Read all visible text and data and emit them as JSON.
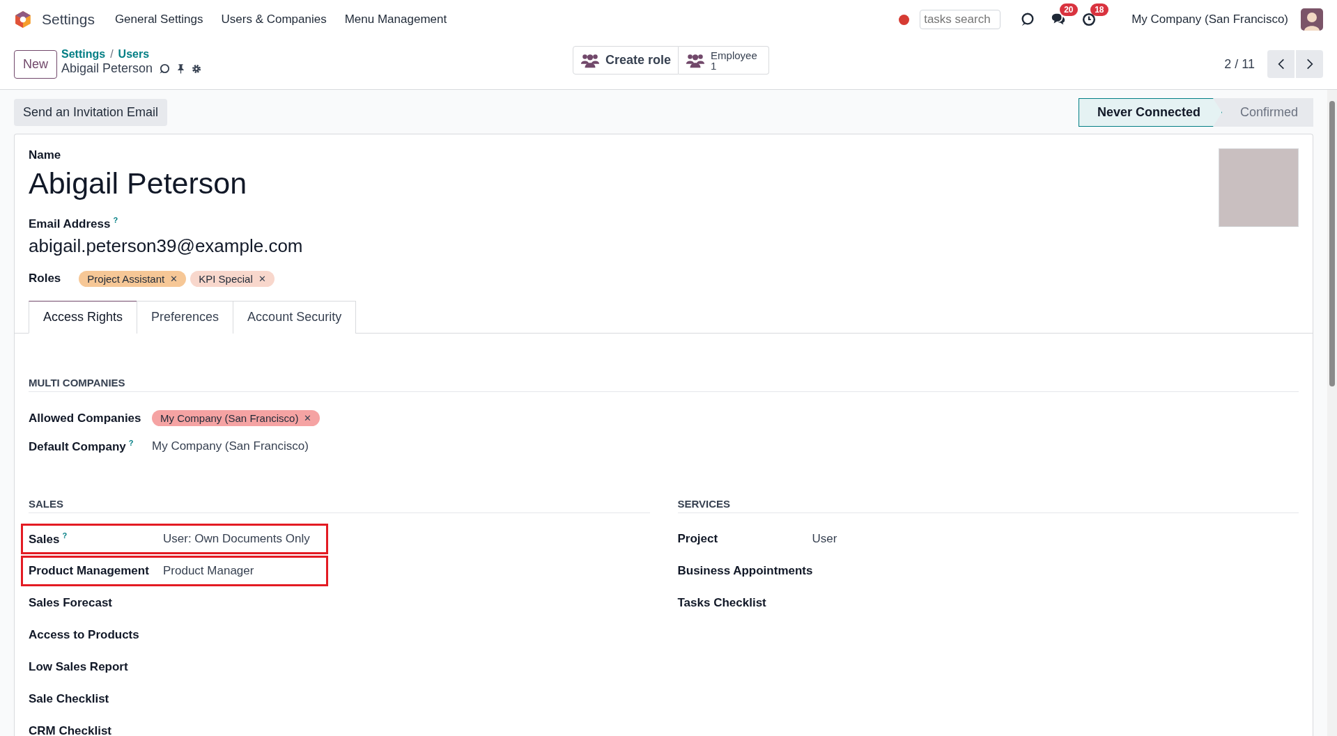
{
  "navbar": {
    "app_name": "Settings",
    "menu": [
      "General Settings",
      "Users & Companies",
      "Menu Management"
    ],
    "search": {
      "placeholder": "tasks search"
    },
    "messages_badge": "20",
    "activities_badge": "18",
    "company": "My Company (San Francisco)"
  },
  "control_panel": {
    "new_button": "New",
    "breadcrumbs": [
      "Settings",
      "Users"
    ],
    "breadcrumb_separator": "/",
    "record_title": "Abigail Peterson",
    "smart_buttons": [
      {
        "label": "Create role"
      },
      {
        "label": "Employee",
        "count": "1"
      }
    ],
    "pager": "2 / 11"
  },
  "header": {
    "action_button": "Send an Invitation Email",
    "statusbar": [
      {
        "label": "Never Connected",
        "selected": true
      },
      {
        "label": "Confirmed",
        "selected": false
      }
    ]
  },
  "form": {
    "name_label": "Name",
    "name": "Abigail Peterson",
    "email_label": "Email Address",
    "email_help": "?",
    "email": "abigail.peterson39@example.com",
    "roles_label": "Roles",
    "roles": [
      {
        "label": "Project Assistant",
        "color": "#f6c796",
        "remove": "✕"
      },
      {
        "label": "KPI Special",
        "color": "#f8d7cc",
        "remove": "✕"
      }
    ],
    "tabs": [
      {
        "label": "Access Rights",
        "selected": true
      },
      {
        "label": "Preferences",
        "selected": false
      },
      {
        "label": "Account Security",
        "selected": false
      }
    ]
  },
  "multi_companies": {
    "title": "MULTI COMPANIES",
    "allowed_label": "Allowed Companies",
    "allowed": [
      {
        "label": "My Company (San Francisco)",
        "color": "#f5a3a3",
        "remove": "✕"
      }
    ],
    "default_label": "Default Company",
    "default_help": "?",
    "default_value": "My Company (San Francisco)"
  },
  "sections": [
    {
      "title": "SALES",
      "fields": [
        {
          "label": "Sales",
          "help": "?",
          "value": "User: Own Documents Only",
          "highlighted": true
        },
        {
          "label": "Product Management",
          "value": "Product Manager",
          "highlighted": true
        },
        {
          "label": "Sales Forecast",
          "highlighted": false
        },
        {
          "label": "Access to Products",
          "highlighted": false
        },
        {
          "label": "Low Sales Report",
          "highlighted": false
        },
        {
          "label": "Sale Checklist",
          "highlighted": false
        },
        {
          "label": "CRM Checklist",
          "highlighted": false
        }
      ]
    },
    {
      "title": "SERVICES",
      "fields": [
        {
          "label": "Project",
          "value": "User",
          "highlighted": false
        },
        {
          "label": "Business Appointments",
          "highlighted": false
        },
        {
          "label": "Tasks Checklist",
          "highlighted": false
        }
      ]
    }
  ]
}
